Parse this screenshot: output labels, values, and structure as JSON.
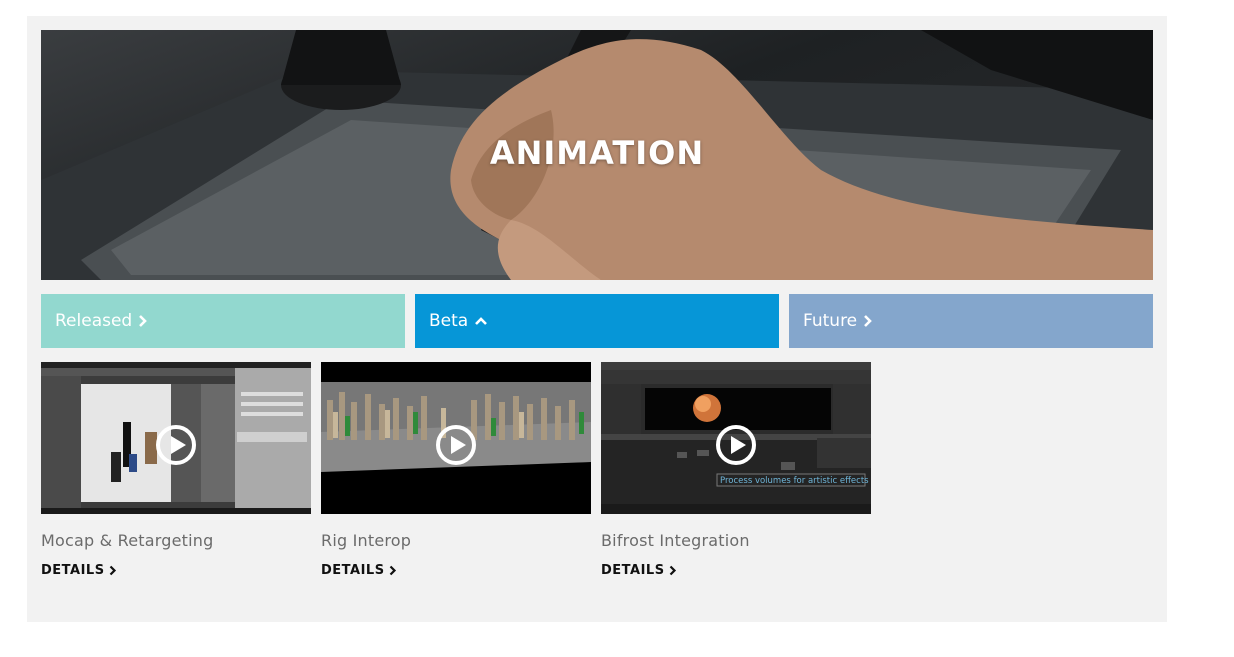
{
  "hero": {
    "title": "ANIMATION"
  },
  "tabs": [
    {
      "label": "Released",
      "icon": "chevron-right-icon",
      "color": "#92d8cf"
    },
    {
      "label": "Beta",
      "icon": "chevron-up-icon",
      "color": "#0696d7"
    },
    {
      "label": "Future",
      "icon": "chevron-right-icon",
      "color": "#84a6cc"
    }
  ],
  "videos": [
    {
      "title": "Mocap & Retargeting",
      "details_label": "DETAILS",
      "icon": "play-icon"
    },
    {
      "title": "Rig Interop",
      "details_label": "DETAILS",
      "icon": "play-icon"
    },
    {
      "title": "Bifrost Integration",
      "details_label": "DETAILS",
      "icon": "play-icon",
      "overlay_caption": "Process volumes for artistic effects"
    }
  ],
  "colors": {
    "panel_bg": "#f2f2f2",
    "title_text": "#6b6b6b",
    "details_text": "#111111"
  }
}
